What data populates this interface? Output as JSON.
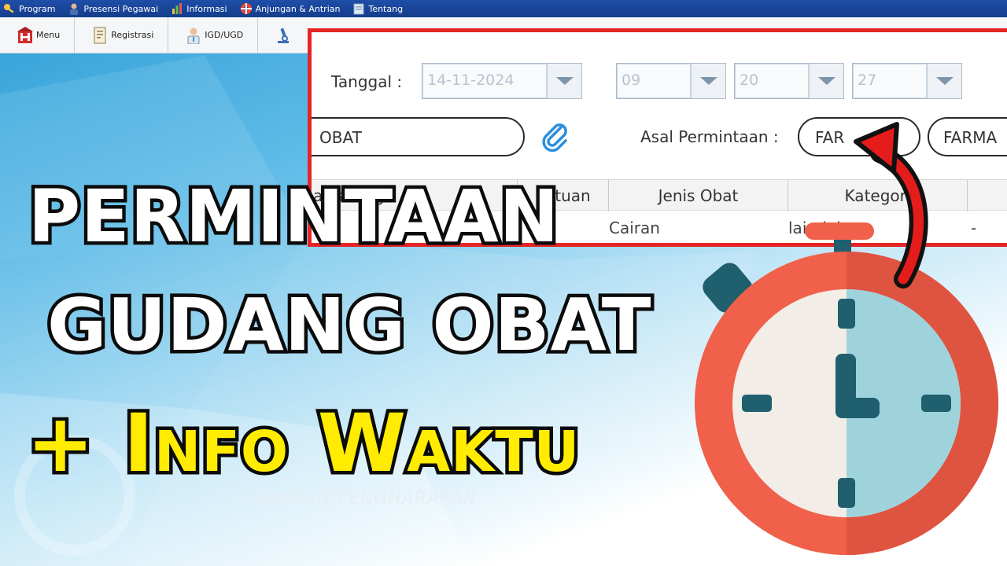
{
  "menubar": {
    "items": [
      {
        "label": "Program",
        "icon": "key-icon"
      },
      {
        "label": "Presensi Pegawai",
        "icon": "employee-icon"
      },
      {
        "label": "Informasi",
        "icon": "chart-icon"
      },
      {
        "label": "Anjungan & Antrian",
        "icon": "lifebuoy-icon"
      },
      {
        "label": "Tentang",
        "icon": "note-icon"
      }
    ]
  },
  "toolbar": {
    "items": [
      {
        "label": "Menu",
        "icon": "hospital-icon"
      },
      {
        "label": "Registrasi",
        "icon": "document-icon"
      },
      {
        "label": "IGD/UGD",
        "icon": "doctor-icon"
      },
      {
        "label": "",
        "icon": "microscope-icon"
      }
    ]
  },
  "form": {
    "tanggal_label": "Tanggal :",
    "date_value": "14-11-2024",
    "hour_value": "09",
    "minute_value": "20",
    "second_value": "27",
    "jenis_value": "OBAT",
    "asal_label": "Asal Permintaan :",
    "asal_code": "FAR",
    "asal_name": "FARMA",
    "columns": [
      "a Barang",
      "Satuan",
      "Jenis Obat",
      "Kategori",
      ""
    ],
    "row": {
      "satuan": "",
      "jenis": "Cairan",
      "kategori": "lain-lain",
      "extra": "-"
    }
  },
  "headline": {
    "line1": "PERMINTAAN",
    "line2": "GUDANG OBAT",
    "line3": "+ Info Waktu"
  },
  "watermark": "HARAPAN PENGHARAPAN",
  "colors": {
    "highlight_border": "#e52525",
    "headline_yellow": "#ffec00",
    "stopwatch_red": "#f0604a",
    "stopwatch_face": "#f2ede6",
    "stopwatch_blue": "#9fd3dc",
    "stopwatch_dark": "#1f5f6e"
  }
}
